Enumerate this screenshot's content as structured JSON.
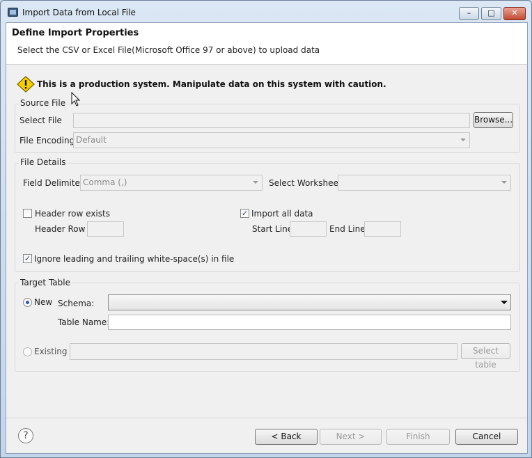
{
  "window": {
    "title": "Import Data from Local File",
    "minimize_icon": "–",
    "maximize_icon": "□",
    "close_icon": "✕"
  },
  "header": {
    "title": "Define Import Properties",
    "description": "Select the CSV or Excel File(Microsoft Office 97 or above) to upload data"
  },
  "warning": {
    "icon": "warning-icon",
    "text": "This is a production system. Manipulate data on this system with caution."
  },
  "source_file": {
    "title": "Source File",
    "select_file_label": "Select File",
    "select_file_value": "",
    "browse_label": "Browse...",
    "encoding_label": "File Encoding",
    "encoding_value": "Default"
  },
  "file_details": {
    "title": "File Details",
    "delimiter_label": "Field Delimiter",
    "delimiter_value": "Comma (,)",
    "worksheet_label": "Select Worksheet:",
    "worksheet_value": "",
    "header_row_exists_label": "Header row exists",
    "header_row_exists_checked": false,
    "header_row_label": "Header Row :",
    "header_row_value": "",
    "import_all_label": "Import all data",
    "import_all_checked": true,
    "start_line_label": "Start Line",
    "start_line_value": "",
    "end_line_label": "End Line",
    "end_line_value": "",
    "ignore_whitespace_label": "Ignore leading and trailing white-space(s) in file",
    "ignore_whitespace_checked": true,
    "check_mark": "✓"
  },
  "target_table": {
    "title": "Target Table",
    "new_label": "New",
    "new_selected": true,
    "schema_label": "Schema:",
    "schema_value": "",
    "table_name_label": "Table Name:",
    "table_name_value": "",
    "existing_label": "Existing",
    "existing_value": "",
    "select_table_label": "Select table"
  },
  "footer": {
    "help_icon": "?",
    "back_label": "< Back",
    "next_label": "Next >",
    "finish_label": "Finish",
    "cancel_label": "Cancel"
  },
  "colors": {
    "title_bar": "#c2d5ea",
    "dialog_bg": "#f0f0f0",
    "header_bg": "#ffffff",
    "close_button": "#c24a33",
    "warning": "#f5d000"
  }
}
